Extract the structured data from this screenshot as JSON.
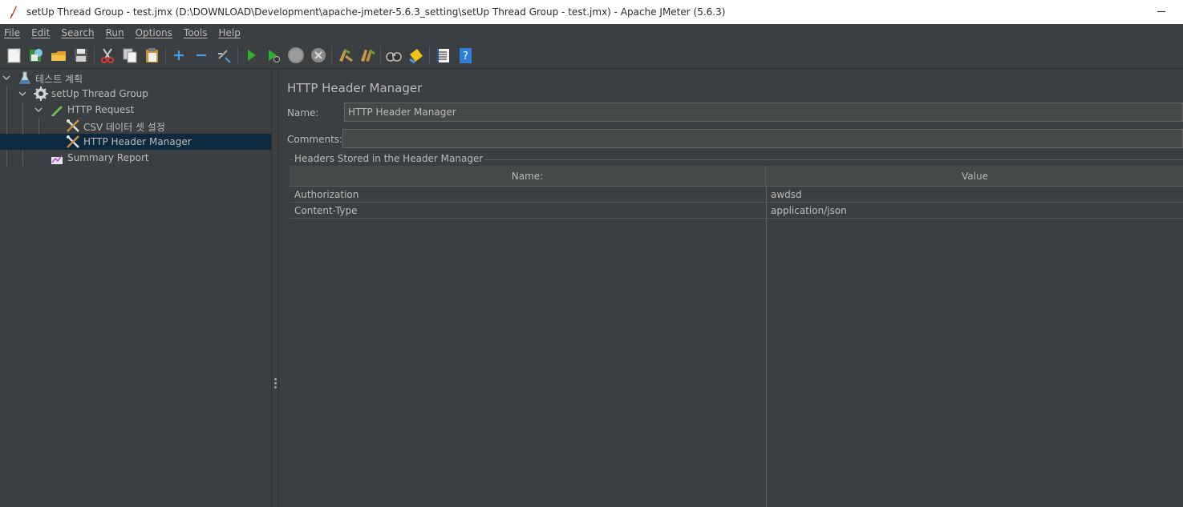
{
  "window": {
    "title": "setUp Thread Group - test.jmx (D:\\DOWNLOAD\\Development\\apache-jmeter-5.6.3_setting\\setUp Thread Group - test.jmx) - Apache JMeter (5.6.3)"
  },
  "menu": [
    "File",
    "Edit",
    "Search",
    "Run",
    "Options",
    "Tools",
    "Help"
  ],
  "toolbar": {
    "icons": [
      "new-icon",
      "templates-icon",
      "open-icon",
      "save-icon",
      "cut-icon",
      "copy-icon",
      "paste-icon",
      "expand-icon",
      "collapse-icon",
      "toggle-icon",
      "start-icon",
      "start-no-pauses-icon",
      "stop-icon",
      "shutdown-icon",
      "clear-icon",
      "clear-all-icon",
      "search-icon",
      "reset-search-icon",
      "function-helper-icon",
      "help-icon"
    ]
  },
  "tree": {
    "items": [
      {
        "label": "테스트 계획",
        "icon": "test-plan-icon"
      },
      {
        "label": "setUp Thread Group",
        "icon": "thread-group-gear-icon"
      },
      {
        "label": "HTTP Request",
        "icon": "sampler-pen-icon"
      },
      {
        "label": "CSV 데이터 셋 설정",
        "icon": "config-tools-icon"
      },
      {
        "label": "HTTP Header Manager",
        "icon": "config-tools-icon",
        "selected": true
      },
      {
        "label": "Summary Report",
        "icon": "listener-chart-icon"
      }
    ]
  },
  "panel": {
    "title": "HTTP Header Manager",
    "name_label": "Name:",
    "name_value": "HTTP Header Manager",
    "comments_label": "Comments:",
    "comments_value": "",
    "group_title": "Headers Stored in the Header Manager",
    "table": {
      "columns": [
        "Name:",
        "Value"
      ],
      "rows": [
        [
          "Authorization",
          "awdsd"
        ],
        [
          "Content-Type",
          "application/json"
        ]
      ]
    }
  },
  "colors": {
    "background": "#3c3f41",
    "selection": "#0d293e",
    "text": "#bbbbbb",
    "start_green": "#2fb12f"
  }
}
